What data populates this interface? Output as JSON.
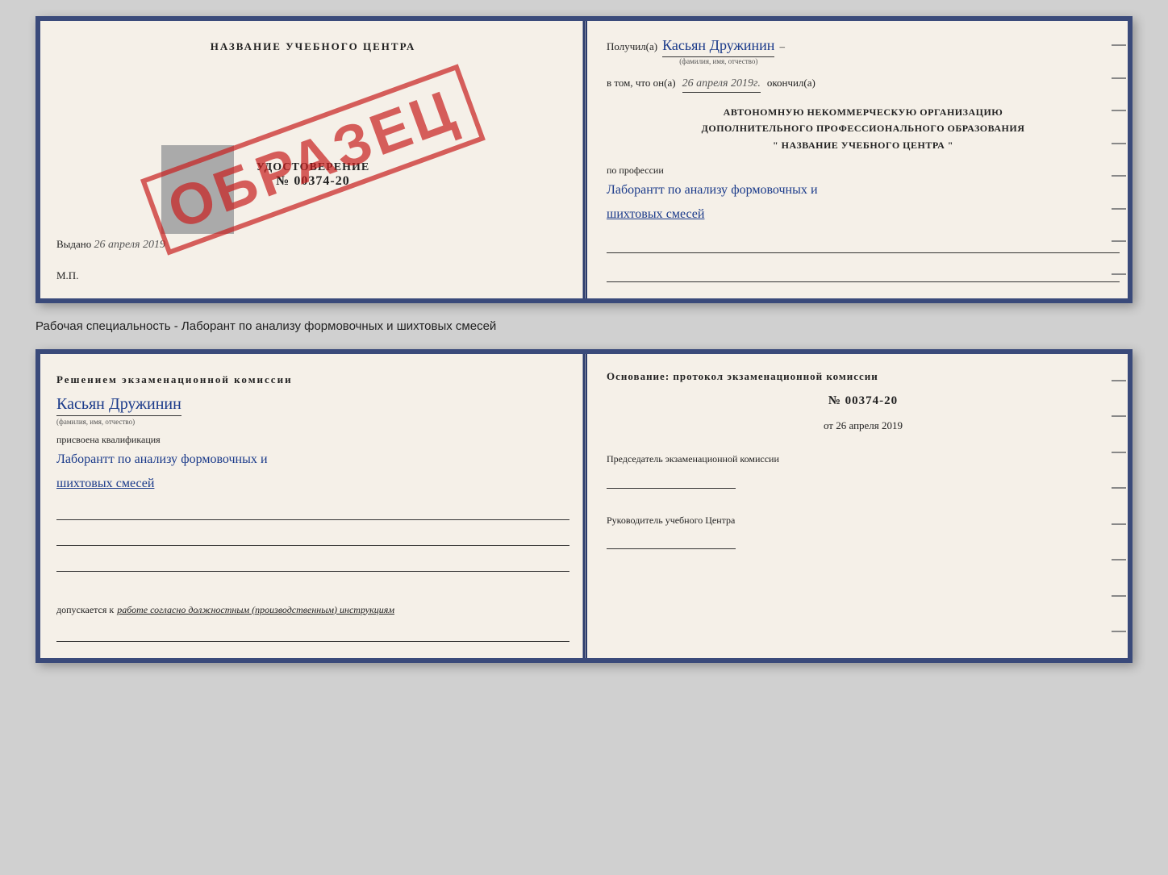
{
  "upper_cert": {
    "left": {
      "title": "НАЗВАНИЕ УЧЕБНОГО ЦЕНТРА",
      "udostoverenie": "УДОСТОВЕРЕНИЕ",
      "number": "№ 00374-20",
      "stamp": "ОБРАЗЕЦ",
      "issued": "Выдано",
      "issued_date": "26 апреля 2019",
      "mp": "М.П."
    },
    "right": {
      "poluchil": "Получил(а)",
      "name": "Касьян Дружинин",
      "name_hint": "(фамилия, имя, отчество)",
      "vtom": "в том, что он(а)",
      "date": "26 апреля 2019г.",
      "okonchil": "окончил(а)",
      "org_line1": "АВТОНОМНУЮ НЕКОММЕРЧЕСКУЮ ОРГАНИЗАЦИЮ",
      "org_line2": "ДОПОЛНИТЕЛЬНОГО ПРОФЕССИОНАЛЬНОГО ОБРАЗОВАНИЯ",
      "org_line3": "\"   НАЗВАНИЕ УЧЕБНОГО ЦЕНТРА   \"",
      "po_professii": "по профессии",
      "profession_line1": "Лаборантт по анализу формовочных и",
      "profession_line2": "шихтовых смесей"
    }
  },
  "middle_text": "Рабочая специальность - Лаборант по анализу формовочных и шихтовых смесей",
  "lower_cert": {
    "left": {
      "header": "Решением  экзаменационной  комиссии",
      "name": "Касьян Дружинин",
      "name_hint": "(фамилия, имя, отчество)",
      "prisvoena": "присвоена квалификация",
      "qualification_line1": "Лаборантт по анализу формовочных и",
      "qualification_line2": "шихтовых смесей",
      "dopuskaetsya": "допускается к",
      "dopuskaetsya_italic": "работе согласно должностным (производственным) инструкциям"
    },
    "right": {
      "osnovanie": "Основание: протокол экзаменационной  комиссии",
      "number": "№ 00374-20",
      "ot": "от",
      "date": "26 апреля 2019",
      "predsedatel_label": "Председатель экзаменационной комиссии",
      "rukovoditel_label": "Руководитель учебного Центра"
    }
  }
}
